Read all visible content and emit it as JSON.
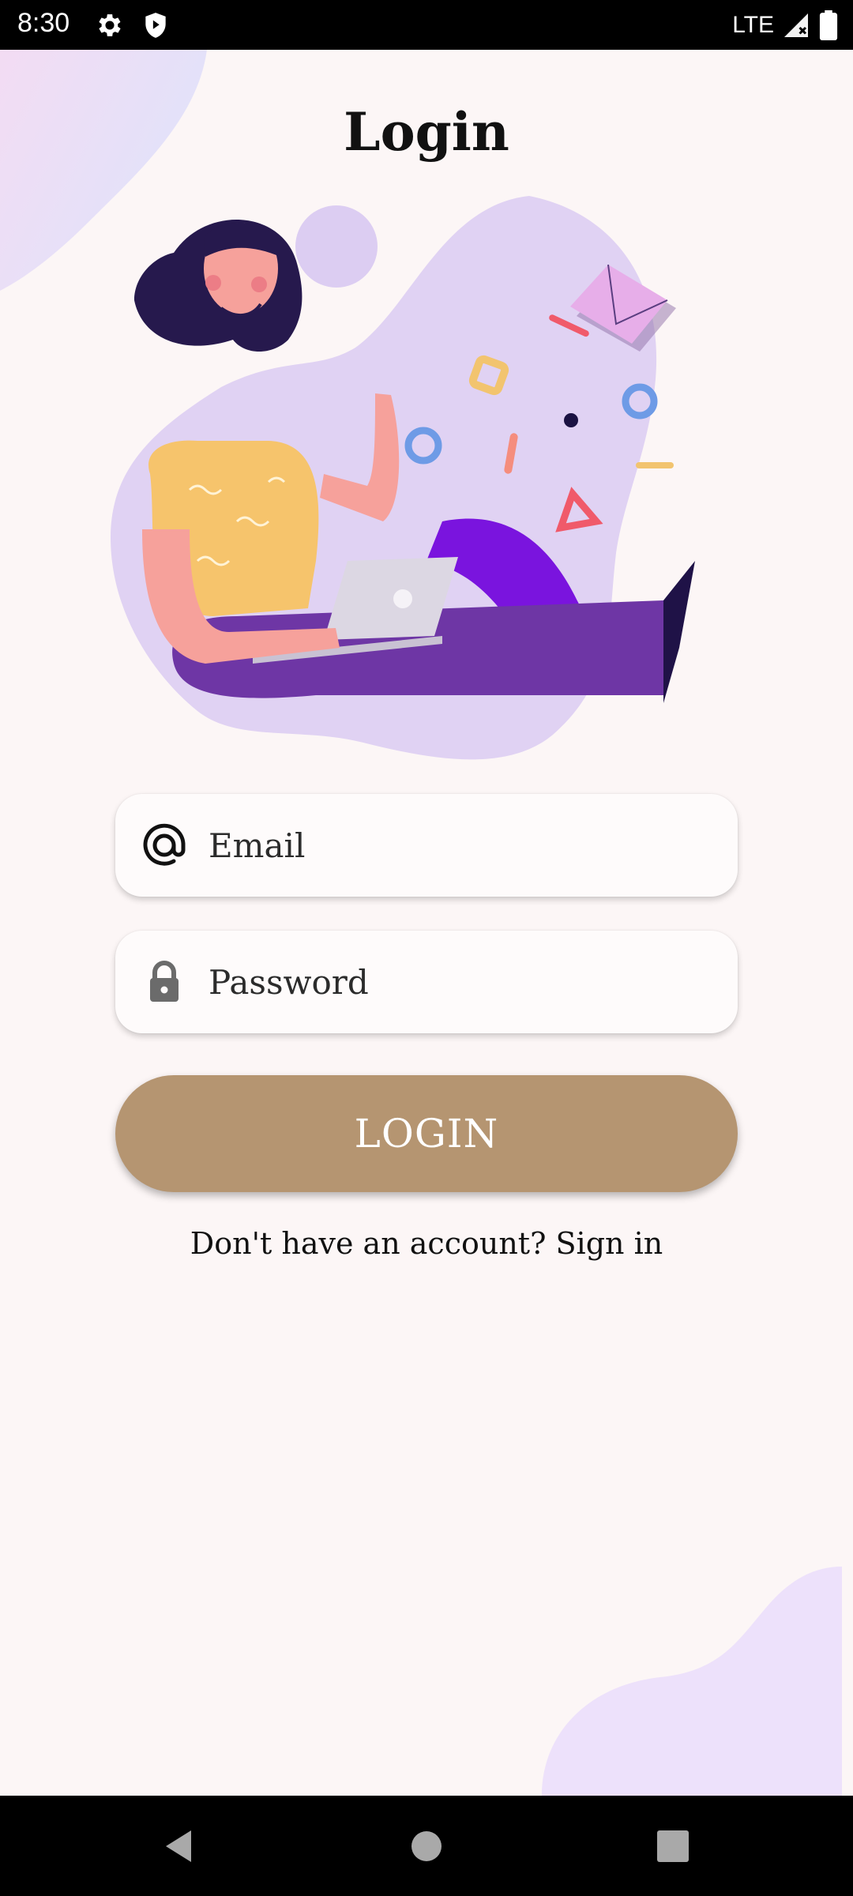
{
  "status_bar": {
    "time": "8:30",
    "network": "LTE",
    "icons": [
      "settings-icon",
      "shield-icon",
      "signal-icon",
      "battery-icon"
    ]
  },
  "login": {
    "title": "Login",
    "email_placeholder": "Email",
    "password_placeholder": "Password",
    "button_label": "LOGIN",
    "signup_prompt": "Don't have an account? Sign in"
  },
  "nav_bar": {
    "icons": [
      "back-icon",
      "home-icon",
      "recents-icon"
    ]
  },
  "colors": {
    "background": "#fcf6f6",
    "button": "#b59571",
    "accent_purple": "#7b18dd",
    "blob_lavender": "#e0d2f3"
  }
}
